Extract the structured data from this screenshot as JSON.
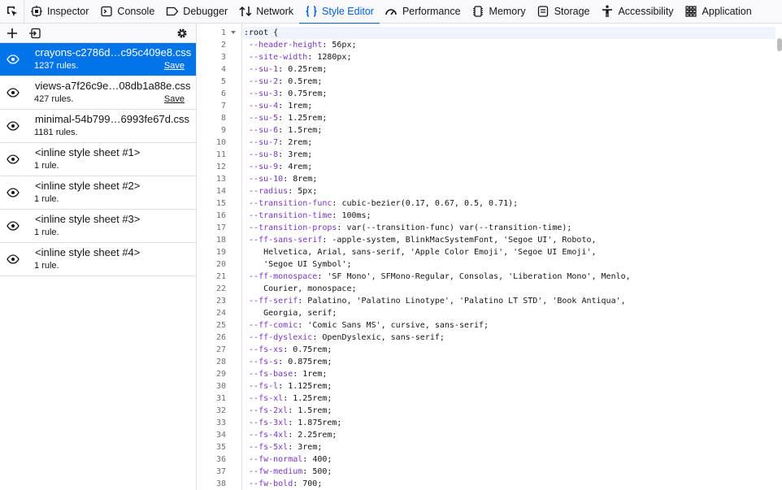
{
  "toolbar": {
    "tabs": [
      {
        "label": "Inspector",
        "icon": "inspector-icon"
      },
      {
        "label": "Console",
        "icon": "console-icon"
      },
      {
        "label": "Debugger",
        "icon": "debugger-icon"
      },
      {
        "label": "Network",
        "icon": "network-icon"
      },
      {
        "label": "Style Editor",
        "icon": "style-editor-icon",
        "active": true
      },
      {
        "label": "Performance",
        "icon": "performance-icon"
      },
      {
        "label": "Memory",
        "icon": "memory-icon"
      },
      {
        "label": "Storage",
        "icon": "storage-icon"
      },
      {
        "label": "Accessibility",
        "icon": "accessibility-icon"
      },
      {
        "label": "Application",
        "icon": "application-icon"
      }
    ],
    "accent_color": "#0061e0"
  },
  "sidebar": {
    "sheets": [
      {
        "name": "crayons-c2786d…c95c409e8.css",
        "rules": "1237 rules.",
        "save": "Save",
        "selected": true
      },
      {
        "name": "views-a7f26c9e…08db1a88e.css",
        "rules": "427 rules.",
        "save": "Save"
      },
      {
        "name": "minimal-54b799…6993fe67d.css",
        "rules": "1181 rules."
      },
      {
        "name": "<inline style sheet #1>",
        "rules": "1 rule."
      },
      {
        "name": "<inline style sheet #2>",
        "rules": "1 rule."
      },
      {
        "name": "<inline style sheet #3>",
        "rules": "1 rule."
      },
      {
        "name": "<inline style sheet #4>",
        "rules": "1 rule."
      }
    ],
    "selected_color": "#0074e8"
  },
  "editor": {
    "lines": [
      {
        "n": "1",
        "text": ":root {"
      },
      {
        "n": "2",
        "prop": "--header-height",
        "val": " 56px;"
      },
      {
        "n": "3",
        "prop": "--site-width",
        "val": " 1280px;"
      },
      {
        "n": "4",
        "prop": "--su-1",
        "val": " 0.25rem;"
      },
      {
        "n": "5",
        "prop": "--su-2",
        "val": " 0.5rem;"
      },
      {
        "n": "6",
        "prop": "--su-3",
        "val": " 0.75rem;"
      },
      {
        "n": "7",
        "prop": "--su-4",
        "val": " 1rem;"
      },
      {
        "n": "8",
        "prop": "--su-5",
        "val": " 1.25rem;"
      },
      {
        "n": "9",
        "prop": "--su-6",
        "val": " 1.5rem;"
      },
      {
        "n": "10",
        "prop": "--su-7",
        "val": " 2rem;"
      },
      {
        "n": "11",
        "prop": "--su-8",
        "val": " 3rem;"
      },
      {
        "n": "12",
        "prop": "--su-9",
        "val": " 4rem;"
      },
      {
        "n": "13",
        "prop": "--su-10",
        "val": " 8rem;"
      },
      {
        "n": "14",
        "prop": "--radius",
        "val": " 5px;"
      },
      {
        "n": "15",
        "prop": "--transition-func",
        "val": " cubic-bezier(0.17, 0.67, 0.5, 0.71);"
      },
      {
        "n": "16",
        "prop": "--transition-time",
        "val": " 100ms;"
      },
      {
        "n": "17",
        "prop": "--transition-props",
        "val": " var(--transition-func) var(--transition-time);"
      },
      {
        "n": "18",
        "prop": "--ff-sans-serif",
        "val": " -apple-system, BlinkMacSystemFont, 'Segoe UI', Roboto,"
      },
      {
        "n": "19",
        "cont": "Helvetica, Arial, sans-serif, 'Apple Color Emoji', 'Segoe UI Emoji',"
      },
      {
        "n": "20",
        "cont": "'Segoe UI Symbol';"
      },
      {
        "n": "21",
        "prop": "--ff-monospace",
        "val": " 'SF Mono', SFMono-Regular, Consolas, 'Liberation Mono', Menlo,"
      },
      {
        "n": "22",
        "cont": "Courier, monospace;"
      },
      {
        "n": "23",
        "prop": "--ff-serif",
        "val": " Palatino, 'Palatino Linotype', 'Palatino LT STD', 'Book Antiqua',"
      },
      {
        "n": "24",
        "cont": "Georgia, serif;"
      },
      {
        "n": "25",
        "prop": "--ff-comic",
        "val": " 'Comic Sans MS', cursive, sans-serif;"
      },
      {
        "n": "26",
        "prop": "--ff-dyslexic",
        "val": " OpenDyslexic, sans-serif;"
      },
      {
        "n": "27",
        "prop": "--fs-xs",
        "val": " 0.75rem;"
      },
      {
        "n": "28",
        "prop": "--fs-s",
        "val": " 0.875rem;"
      },
      {
        "n": "29",
        "prop": "--fs-base",
        "val": " 1rem;"
      },
      {
        "n": "30",
        "prop": "--fs-l",
        "val": " 1.125rem;"
      },
      {
        "n": "31",
        "prop": "--fs-xl",
        "val": " 1.25rem;"
      },
      {
        "n": "32",
        "prop": "--fs-2xl",
        "val": " 1.5rem;"
      },
      {
        "n": "33",
        "prop": "--fs-3xl",
        "val": " 1.875rem;"
      },
      {
        "n": "34",
        "prop": "--fs-4xl",
        "val": " 2.25rem;"
      },
      {
        "n": "35",
        "prop": "--fs-5xl",
        "val": " 3rem;"
      },
      {
        "n": "36",
        "prop": "--fw-normal",
        "val": " 400;"
      },
      {
        "n": "37",
        "prop": "--fw-medium",
        "val": " 500;"
      },
      {
        "n": "38",
        "prop": "--fw-bold",
        "val": " 700;"
      }
    ],
    "property_color": "#7a36c7"
  }
}
